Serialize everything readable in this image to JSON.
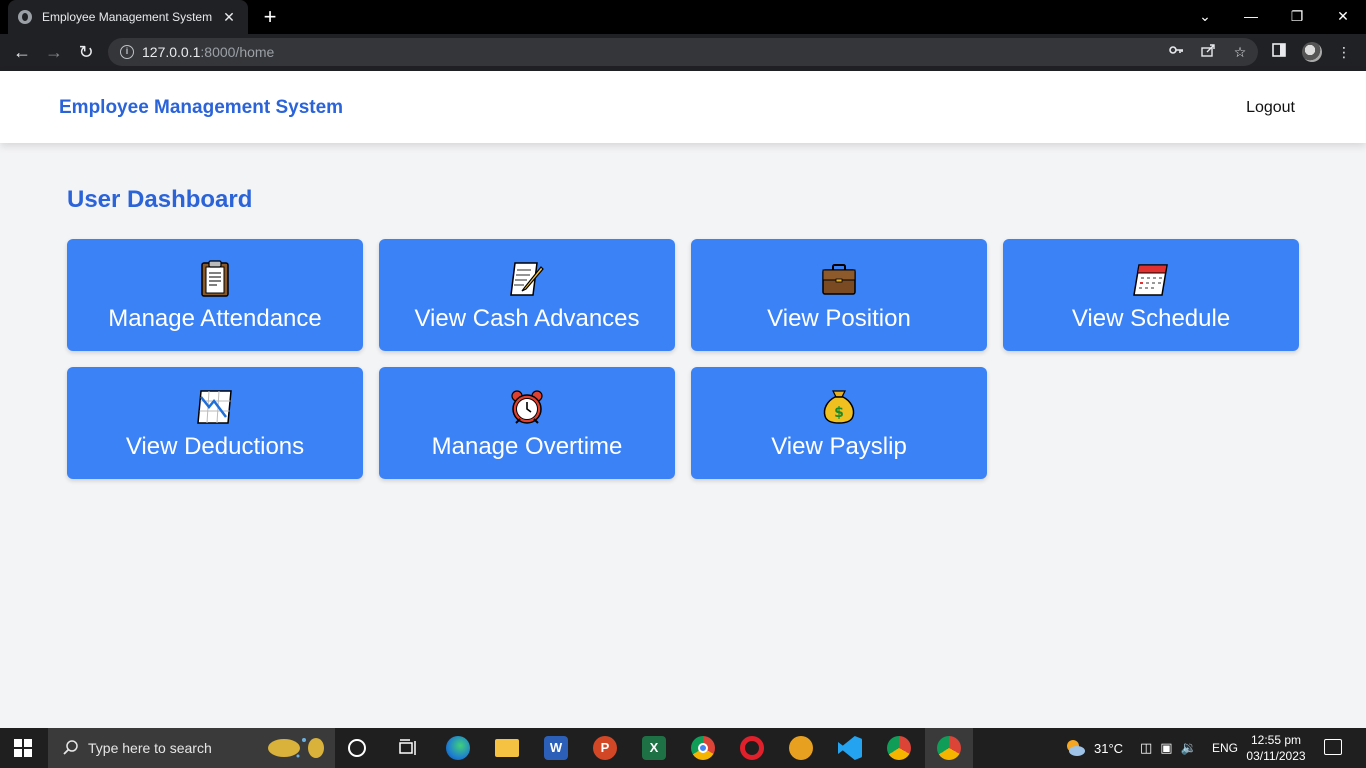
{
  "browser": {
    "tab_title": "Employee Management System",
    "tab_close": "✕",
    "new_tab": "+",
    "url_host": "127.0.0.1",
    "url_path": ":8000/home",
    "window_controls": {
      "minimize": "—",
      "restore": "❐",
      "close": "✕",
      "dropdown": "⌄"
    }
  },
  "header": {
    "brand": "Employee Management System",
    "logout": "Logout"
  },
  "dashboard": {
    "title": "User Dashboard",
    "cards": [
      {
        "label": "Manage Attendance",
        "icon": "clipboard-icon"
      },
      {
        "label": "View Cash Advances",
        "icon": "memo-icon"
      },
      {
        "label": "View Position",
        "icon": "briefcase-icon"
      },
      {
        "label": "View Schedule",
        "icon": "calendar-icon"
      },
      {
        "label": "View Deductions",
        "icon": "chart-decreasing-icon"
      },
      {
        "label": "Manage Overtime",
        "icon": "alarm-clock-icon"
      },
      {
        "label": "View Payslip",
        "icon": "money-bag-icon"
      }
    ],
    "card_color": "#3b82f6",
    "title_color": "#2b63d9"
  },
  "taskbar": {
    "search_placeholder": "Type here to search",
    "weather": "31°C",
    "language": "ENG",
    "time": "12:55 pm",
    "date": "03/11/2023"
  }
}
